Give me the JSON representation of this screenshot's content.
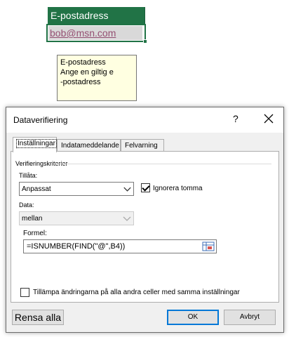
{
  "sheet": {
    "header_cell": "E-postadress",
    "selected_cell": "bob@msn.com"
  },
  "tooltip": {
    "title": "E-postadress",
    "line1": "Ange en giltig e",
    "line2": "-postadress"
  },
  "dialog": {
    "title": "Dataverifiering",
    "help": "?",
    "tabs": [
      "Inställningar",
      "Indatameddelande",
      "Felvarning"
    ],
    "group_label": "Verifieringskriterier",
    "allow_label": "Tillåta:",
    "allow_value": "Anpassat",
    "ignore_blank_label": "Ignorera tomma",
    "ignore_blank_checked": true,
    "data_label": "Data:",
    "data_value": "mellan",
    "formula_label": "Formel:",
    "formula_value": "=ISNUMBER(FIND(\"@\",B4))",
    "apply_all_label": "Tillämpa ändringarna på alla andra celler med samma inställningar",
    "apply_all_checked": false,
    "buttons": {
      "clear_all": "Rensa alla",
      "ok": "OK",
      "cancel": "Avbryt"
    }
  },
  "colors": {
    "excel_green": "#217346",
    "tooltip_bg": "#ffffe1",
    "focus_blue": "#0078d7",
    "hyperlink": "#954f72"
  }
}
